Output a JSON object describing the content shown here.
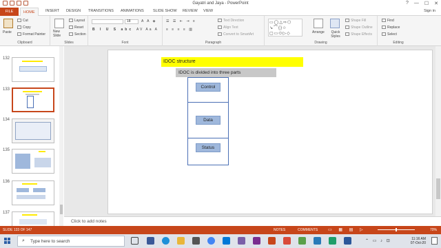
{
  "window": {
    "title": "Gayatri and Jaya - PowerPoint",
    "sign_in": "Sign in",
    "controls": [
      "?",
      "—",
      "☐",
      "✕"
    ]
  },
  "tabs": [
    "FILE",
    "HOME",
    "INSERT",
    "DESIGN",
    "TRANSITIONS",
    "ANIMATIONS",
    "SLIDE SHOW",
    "REVIEW",
    "VIEW"
  ],
  "ribbon": {
    "clipboard": {
      "paste": "Paste",
      "cut": "Cut",
      "copy": "Copy",
      "format_painter": "Format Painter",
      "label": "Clipboard"
    },
    "slides": {
      "new_slide": "New Slide",
      "layout": "Layout",
      "reset": "Reset",
      "section": "Section",
      "label": "Slides"
    },
    "font": {
      "label": "Font",
      "size": "18"
    },
    "paragraph": {
      "text_direction": "Text Direction",
      "align_text": "Align Text",
      "convert_smartart": "Convert to SmartArt",
      "label": "Paragraph"
    },
    "drawing": {
      "arrange": "Arrange",
      "quick_styles": "Quick Styles",
      "shape_fill": "Shape Fill",
      "shape_outline": "Shape Outline",
      "shape_effects": "Shape Effects",
      "label": "Drawing"
    },
    "editing": {
      "find": "Find",
      "replace": "Replace",
      "select": "Select",
      "label": "Editing"
    }
  },
  "thumbnails": [
    {
      "num": "132",
      "selected": false
    },
    {
      "num": "133",
      "selected": true
    },
    {
      "num": "134",
      "selected": false
    },
    {
      "num": "135",
      "selected": false
    },
    {
      "num": "136",
      "selected": false
    },
    {
      "num": "137",
      "selected": false
    }
  ],
  "slide": {
    "title": "IDOC structure",
    "subtitle": "IDOC is divided into three parts",
    "parts": [
      "Control",
      "Data",
      "Status"
    ]
  },
  "notes_placeholder": "Click to add notes",
  "status": {
    "slide_indicator": "SLIDE 133 OF 147",
    "notes": "NOTES",
    "comments": "COMMENTS",
    "zoom": "70%"
  },
  "taskbar": {
    "search_placeholder": "Type here to search",
    "time": "11:16 AM",
    "date": "07-Oct-20"
  },
  "colors": {
    "accent": "#c7461a",
    "slide_title_bg": "#ffff00",
    "part_fill": "#9fb8dc"
  }
}
